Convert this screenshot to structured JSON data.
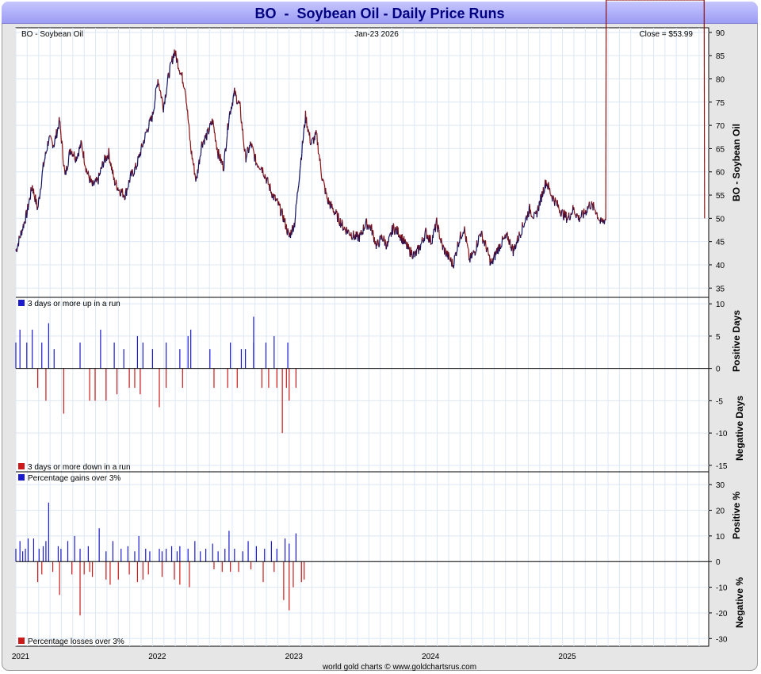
{
  "title": "BO  -  Soybean Oil - Daily Price Runs",
  "header": {
    "symbol": "BO  -  Soybean Oil",
    "date": "Jan-23  2026",
    "close": "Close = $53.99"
  },
  "footer": "world gold charts © www.goldchartsrus.com",
  "colors": {
    "up": "#1a1acc",
    "down": "#cc1a1a",
    "price": "#000000",
    "grid": "#dce8f4"
  },
  "chart_data": [
    {
      "type": "line",
      "name": "price",
      "ylabel": "BO  -  Soybean Oil",
      "ylim": [
        33,
        91
      ],
      "yticks": [
        35,
        40,
        45,
        50,
        55,
        60,
        65,
        70,
        75,
        80,
        85,
        90
      ],
      "xlim": [
        2021.0,
        2026.07
      ],
      "xticks": [
        {
          "v": 2021.0,
          "label": "2021"
        },
        {
          "v": 2022.0,
          "label": "2022"
        },
        {
          "v": 2023.0,
          "label": "2023"
        },
        {
          "v": 2024.0,
          "label": "2024"
        },
        {
          "v": 2025.0,
          "label": "2025"
        }
      ],
      "x": [
        2021.0,
        2021.04,
        2021.08,
        2021.12,
        2021.16,
        2021.2,
        2021.24,
        2021.28,
        2021.32,
        2021.36,
        2021.4,
        2021.44,
        2021.48,
        2021.52,
        2021.56,
        2021.6,
        2021.64,
        2021.68,
        2021.72,
        2021.76,
        2021.8,
        2021.84,
        2021.88,
        2021.92,
        2021.96,
        2022.0,
        2022.04,
        2022.08,
        2022.12,
        2022.16,
        2022.2,
        2022.24,
        2022.28,
        2022.32,
        2022.36,
        2022.4,
        2022.44,
        2022.48,
        2022.52,
        2022.56,
        2022.6,
        2022.64,
        2022.68,
        2022.72,
        2022.76,
        2022.8,
        2022.84,
        2022.88,
        2022.92,
        2022.96,
        2023.0,
        2023.04,
        2023.08,
        2023.12,
        2023.16,
        2023.2,
        2023.24,
        2023.28,
        2023.32,
        2023.36,
        2023.4,
        2023.44,
        2023.48,
        2023.52,
        2023.56,
        2023.6,
        2023.64,
        2023.68,
        2023.72,
        2023.76,
        2023.8,
        2023.84,
        2023.88,
        2023.92,
        2023.96,
        2024.0,
        2024.04,
        2024.08,
        2024.12,
        2024.16,
        2024.2,
        2024.24,
        2024.28,
        2024.32,
        2024.36,
        2024.4,
        2024.44,
        2024.48,
        2024.52,
        2024.56,
        2024.6,
        2024.64,
        2024.68,
        2024.72,
        2024.76,
        2024.8,
        2024.84,
        2024.88,
        2024.92,
        2024.96,
        2025.0,
        2025.04,
        2025.08,
        2025.12,
        2025.16,
        2025.2,
        2025.24,
        2025.28,
        2025.32,
        2025.36,
        2025.4,
        2025.44,
        2025.48,
        2025.52,
        2025.56,
        2025.6,
        2025.64,
        2025.68,
        2025.72,
        2025.76,
        2025.8,
        2025.84,
        2025.88,
        2025.92,
        2025.96,
        2026.0,
        2026.04
      ],
      "y": [
        43,
        47,
        51,
        57,
        52,
        61,
        67,
        66,
        71,
        59,
        65,
        63,
        66,
        60,
        57,
        58,
        62,
        64,
        58,
        56,
        55,
        59,
        61,
        65,
        69,
        72,
        80,
        74,
        81,
        86,
        82,
        78,
        65,
        58,
        66,
        68,
        71,
        64,
        61,
        72,
        77,
        74,
        63,
        66,
        62,
        61,
        58,
        55,
        53,
        50,
        46,
        49,
        61,
        72,
        66,
        68,
        59,
        54,
        52,
        50,
        48,
        47,
        46,
        46,
        49,
        48,
        44,
        46,
        44,
        48,
        47,
        45,
        43,
        42,
        44,
        47,
        45,
        49,
        44,
        42,
        40,
        45,
        48,
        41,
        43,
        47,
        44,
        40,
        43,
        45,
        46,
        43,
        46,
        49,
        52,
        50,
        54,
        58,
        55,
        53,
        51,
        50,
        52,
        50,
        51,
        53,
        52,
        49,
        50
      ]
    },
    {
      "type": "bar",
      "name": "runs",
      "ylabel_pos": "Positive Days",
      "ylabel_neg": "Negative Days",
      "legend_up": "3 days or more up in a run",
      "legend_down": "3 days or more down in a run",
      "ylim": [
        -16,
        11
      ],
      "yticks": [
        10,
        5,
        0,
        -5,
        -10,
        -15
      ],
      "up": [
        [
          2021.0,
          4
        ],
        [
          2021.03,
          6
        ],
        [
          2021.08,
          4
        ],
        [
          2021.12,
          6
        ],
        [
          2021.19,
          4
        ],
        [
          2021.24,
          7
        ],
        [
          2021.28,
          3
        ],
        [
          2021.47,
          4
        ],
        [
          2021.62,
          6
        ],
        [
          2021.72,
          4
        ],
        [
          2021.79,
          3
        ],
        [
          2021.89,
          5
        ],
        [
          2021.93,
          4
        ],
        [
          2022.0,
          3
        ],
        [
          2022.1,
          4
        ],
        [
          2022.2,
          3
        ],
        [
          2022.26,
          5
        ],
        [
          2022.42,
          3
        ],
        [
          2022.57,
          4
        ],
        [
          2022.65,
          3
        ],
        [
          2022.74,
          4
        ],
        [
          2022.83,
          4
        ],
        [
          2022.89,
          5
        ],
        [
          2022.99,
          4
        ],
        [
          2022.28,
          6
        ],
        [
          2022.74,
          8
        ],
        [
          2022.68,
          3
        ]
      ],
      "down": [
        [
          2021.16,
          -3
        ],
        [
          2021.22,
          -5
        ],
        [
          2021.35,
          -7
        ],
        [
          2021.54,
          -5
        ],
        [
          2021.58,
          -5
        ],
        [
          2021.66,
          -5
        ],
        [
          2021.74,
          -4
        ],
        [
          2021.83,
          -3
        ],
        [
          2021.87,
          -3
        ],
        [
          2021.91,
          -4
        ],
        [
          2022.05,
          -6
        ],
        [
          2022.1,
          -3
        ],
        [
          2022.22,
          -3
        ],
        [
          2022.45,
          -3
        ],
        [
          2022.55,
          -3
        ],
        [
          2022.62,
          -3
        ],
        [
          2022.8,
          -3
        ],
        [
          2022.85,
          -3
        ],
        [
          2022.91,
          -3
        ],
        [
          2022.95,
          -10
        ],
        [
          2023.0,
          -5
        ],
        [
          2022.98,
          -3
        ],
        [
          2023.05,
          -3
        ]
      ]
    },
    {
      "type": "bar",
      "name": "percentages",
      "ylabel_pos": "Positive %",
      "ylabel_neg": "Negative %",
      "legend_up": "Percentage gains over 3%",
      "legend_down": "Percentage losses over 3%",
      "ylim": [
        -33,
        35
      ],
      "yticks": [
        30,
        20,
        10,
        0,
        -10,
        -20,
        -30
      ],
      "up": [
        [
          2021.0,
          5
        ],
        [
          2021.03,
          8
        ],
        [
          2021.05,
          4
        ],
        [
          2021.07,
          5
        ],
        [
          2021.09,
          9
        ],
        [
          2021.13,
          9
        ],
        [
          2021.17,
          5
        ],
        [
          2021.2,
          6
        ],
        [
          2021.22,
          8
        ],
        [
          2021.24,
          23
        ],
        [
          2021.31,
          6
        ],
        [
          2021.33,
          5
        ],
        [
          2021.38,
          8
        ],
        [
          2021.43,
          10
        ],
        [
          2021.47,
          5
        ],
        [
          2021.53,
          6
        ],
        [
          2021.61,
          13
        ],
        [
          2021.66,
          4
        ],
        [
          2021.71,
          8
        ],
        [
          2021.77,
          5
        ],
        [
          2021.82,
          6
        ],
        [
          2021.87,
          4
        ],
        [
          2021.9,
          10
        ],
        [
          2021.95,
          5
        ],
        [
          2021.98,
          4
        ],
        [
          2022.05,
          5
        ],
        [
          2022.07,
          4
        ],
        [
          2022.1,
          5
        ],
        [
          2022.14,
          6
        ],
        [
          2022.18,
          4
        ],
        [
          2022.2,
          6
        ],
        [
          2022.26,
          5
        ],
        [
          2022.31,
          8
        ],
        [
          2022.35,
          4
        ],
        [
          2022.39,
          5
        ],
        [
          2022.44,
          7
        ],
        [
          2022.48,
          4
        ],
        [
          2022.53,
          5
        ],
        [
          2022.56,
          12
        ],
        [
          2022.6,
          5
        ],
        [
          2022.66,
          4
        ],
        [
          2022.7,
          8
        ],
        [
          2022.76,
          6
        ],
        [
          2022.82,
          5
        ],
        [
          2022.87,
          8
        ],
        [
          2022.91,
          5
        ],
        [
          2022.97,
          9
        ],
        [
          2023.0,
          7
        ],
        [
          2023.05,
          11
        ]
      ],
      "down": [
        [
          2021.16,
          -8
        ],
        [
          2021.19,
          -5
        ],
        [
          2021.27,
          -4
        ],
        [
          2021.32,
          -13
        ],
        [
          2021.41,
          -5
        ],
        [
          2021.47,
          -21
        ],
        [
          2021.5,
          -5
        ],
        [
          2021.54,
          -4
        ],
        [
          2021.56,
          -6
        ],
        [
          2021.66,
          -7
        ],
        [
          2021.69,
          -9
        ],
        [
          2021.75,
          -7
        ],
        [
          2021.83,
          -5
        ],
        [
          2021.89,
          -8
        ],
        [
          2021.93,
          -7
        ],
        [
          2021.97,
          -5
        ],
        [
          2022.07,
          -6
        ],
        [
          2022.16,
          -7
        ],
        [
          2022.2,
          -9
        ],
        [
          2022.27,
          -10
        ],
        [
          2022.45,
          -3
        ],
        [
          2022.51,
          -4
        ],
        [
          2022.57,
          -4
        ],
        [
          2022.63,
          -4
        ],
        [
          2022.72,
          -3
        ],
        [
          2022.81,
          -8
        ],
        [
          2022.89,
          -4
        ],
        [
          2022.96,
          -15
        ],
        [
          2023.0,
          -19
        ],
        [
          2023.03,
          -10
        ],
        [
          2023.09,
          -8
        ],
        [
          2023.11,
          -7
        ]
      ]
    }
  ]
}
